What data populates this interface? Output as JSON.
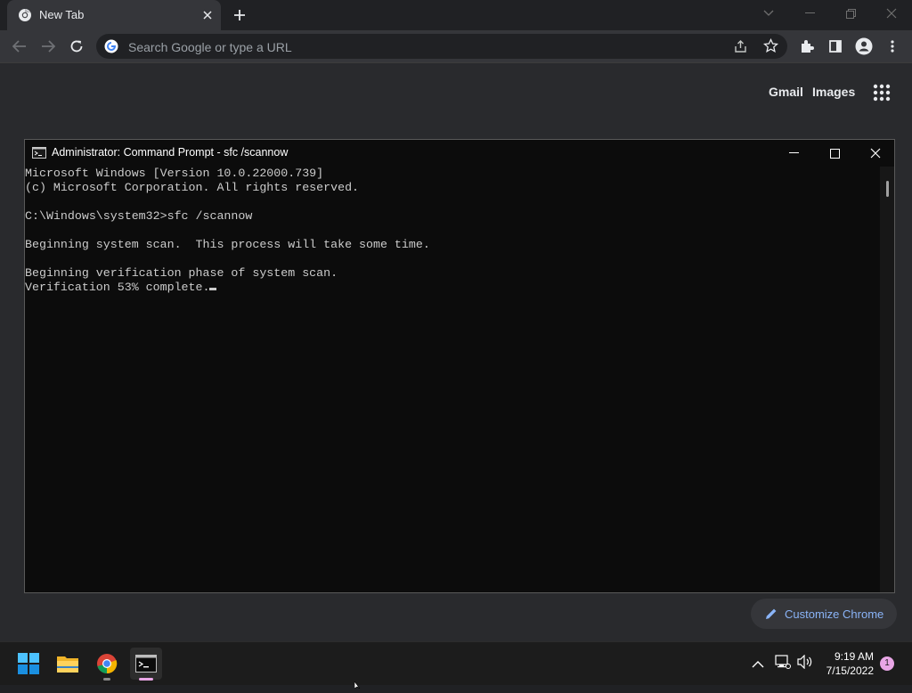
{
  "browser": {
    "tab_title": "New Tab",
    "omnibox_placeholder": "Search Google or type a URL",
    "links": {
      "gmail": "Gmail",
      "images": "Images"
    },
    "customize_label": "Customize Chrome"
  },
  "cmd": {
    "title": "Administrator: Command Prompt - sfc  /scannow",
    "icon_text": "C:\\_",
    "lines": [
      "Microsoft Windows [Version 10.0.22000.739]",
      "(c) Microsoft Corporation. All rights reserved.",
      "",
      "C:\\Windows\\system32>sfc /scannow",
      "",
      "Beginning system scan.  This process will take some time.",
      "",
      "Beginning verification phase of system scan.",
      "Verification 53% complete."
    ]
  },
  "taskbar": {
    "time": "9:19 AM",
    "date": "7/15/2022",
    "notification_count": "1"
  },
  "colors": {
    "accent_link": "#8ab4f8",
    "console_text": "#cccccc",
    "console_bg": "#0c0c0c"
  }
}
